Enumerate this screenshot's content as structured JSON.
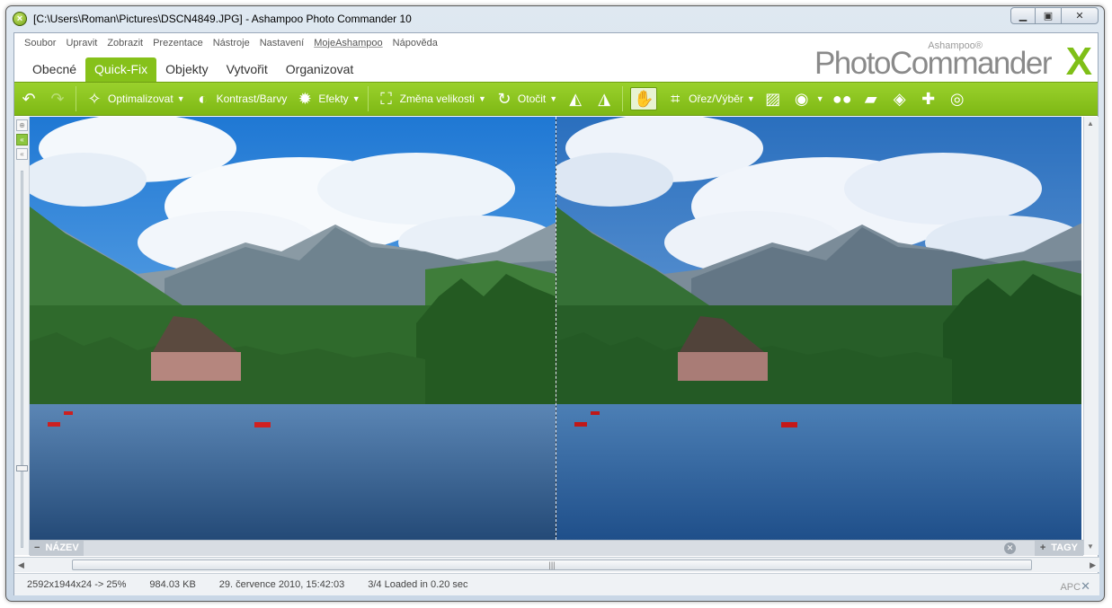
{
  "window": {
    "title": "[C:\\Users\\Roman\\Pictures\\DSCN4849.JPG] - Ashampoo Photo Commander 10",
    "app_icon": "ashampoo-x-icon",
    "controls": [
      "minimize",
      "maximize",
      "close"
    ]
  },
  "menu": [
    "Soubor",
    "Upravit",
    "Zobrazit",
    "Prezentace",
    "Nástroje",
    "Nastavení",
    "MojeAshampoo",
    "Nápověda"
  ],
  "logo": {
    "small": "Ashampoo®",
    "main": "PhotoCommander",
    "mark": "X"
  },
  "tabs": [
    {
      "label": "Obecné",
      "active": false
    },
    {
      "label": "Quick-Fix",
      "active": true
    },
    {
      "label": "Objekty",
      "active": false
    },
    {
      "label": "Vytvořit",
      "active": false
    },
    {
      "label": "Organizovat",
      "active": false
    }
  ],
  "toolbar": {
    "optimize": "Optimalizovat",
    "contrast": "Kontrast/Barvy",
    "effects": "Efekty",
    "resize": "Změna velikosti",
    "rotate": "Otočit",
    "crop": "Ořez/Výběr",
    "icons": {
      "undo": "undo-icon",
      "redo": "redo-icon",
      "wand": "magic-wand-icon",
      "contrast": "half-circle-icon",
      "effects": "starburst-icon",
      "resize": "resize-icon",
      "rotate": "rotate-icon",
      "flip_h": "flip-horizontal-icon",
      "flip_v": "flip-vertical-icon",
      "hand": "hand-icon",
      "crop": "crop-icon",
      "picture": "picture-icon",
      "eye": "red-eye-icon",
      "dots": "dots-icon",
      "eraser": "eraser-icon",
      "bucket": "fill-bucket-icon",
      "bandaid": "bandaid-icon",
      "target": "target-icon"
    }
  },
  "name_bar": {
    "left": "NÁZEV",
    "right": "TAGY",
    "minus": "−",
    "plus": "+"
  },
  "scroll": {
    "thumb_grip": "|||"
  },
  "status": {
    "dimensions": "2592x1944x24 -> 25%",
    "size": "984.03 KB",
    "date": "29. července 2010, 15:42:03",
    "load": "3/4  Loaded in 0.20 sec",
    "brand": "APC"
  },
  "colors": {
    "accent": "#86c11a",
    "toolbar": "#8cc63f",
    "sky": "#2f86d6",
    "water": "#3b6ba0"
  }
}
